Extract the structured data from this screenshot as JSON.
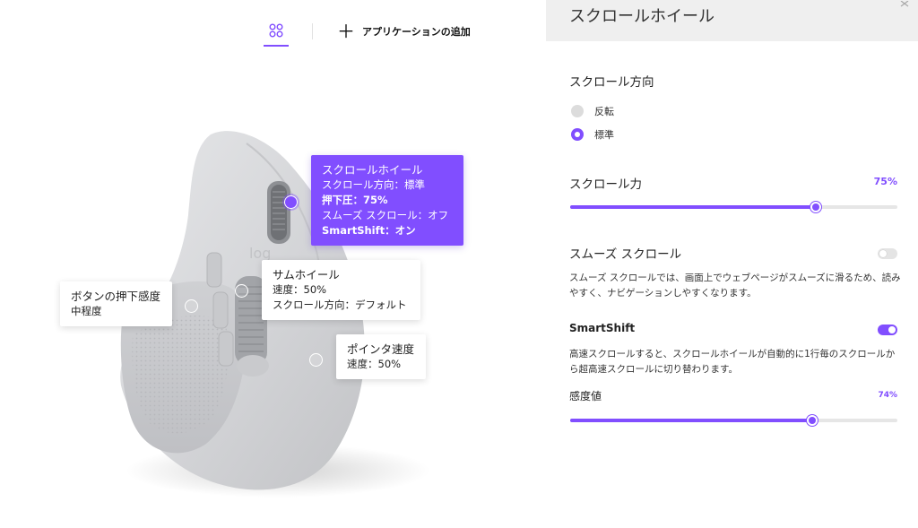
{
  "topbar": {
    "apps_icon": "four-circles-icon",
    "add_icon": "plus-icon",
    "add_app_label": "アプリケーションの追加"
  },
  "callouts": {
    "scroll_wheel": {
      "title": "スクロールホイール",
      "line1": "スクロール方向：標準",
      "line2": "押下圧：75%",
      "line3": "スムーズ スクロール：オフ",
      "line4": "SmartShift：オン"
    },
    "thumb_wheel": {
      "title": "サムホイール",
      "line1": "速度：50%",
      "line2": "スクロール方向：デフォルト"
    },
    "button_press": {
      "title": "ボタンの押下感度",
      "line1": "中程度"
    },
    "pointer_speed": {
      "title": "ポインタ速度",
      "line1": "速度：50%"
    }
  },
  "panel": {
    "title": "スクロールホイール",
    "close_icon": "close-icon",
    "scroll_direction": {
      "label": "スクロール方向",
      "options": [
        {
          "label": "反転",
          "selected": false
        },
        {
          "label": "標準",
          "selected": true
        }
      ]
    },
    "scroll_force": {
      "label": "スクロール力",
      "value_text": "75%",
      "value": 0.75
    },
    "smooth_scroll": {
      "label": "スムーズ スクロール",
      "enabled": false,
      "description": "スムーズ スクロールでは、画面上でウェブページがスムーズに滑るため、読みやすく、ナビゲーションしやすくなります。"
    },
    "smartshift": {
      "label": "SmartShift",
      "enabled": true,
      "description": "高速スクロールすると、スクロールホイールが自動的に1行毎のスクロールから超高速スクロールに切り替わります。",
      "sensitivity_label": "感度値",
      "sensitivity_text": "74%",
      "sensitivity": 0.74
    }
  },
  "colors": {
    "accent": "#814eff",
    "panel_header": "#efefef",
    "mouse_body": "#d7d8da"
  }
}
